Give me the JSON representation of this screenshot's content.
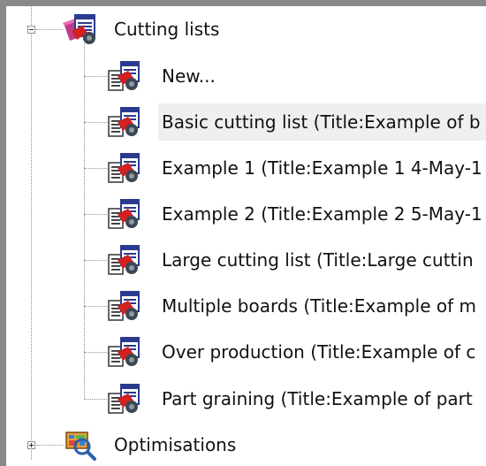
{
  "tree": {
    "root": {
      "label": "Cutting lists",
      "expanded": true,
      "icon": "cutting-list-folder-icon",
      "children": [
        {
          "label": "New...",
          "icon": "cutting-list-doc-icon"
        },
        {
          "label": "Basic cutting list (Title:Example of b",
          "icon": "cutting-list-doc-icon",
          "selected": true
        },
        {
          "label": "Example 1 (Title:Example 1 4-May-1",
          "icon": "cutting-list-doc-icon"
        },
        {
          "label": "Example 2 (Title:Example 2 5-May-1",
          "icon": "cutting-list-doc-icon"
        },
        {
          "label": "Large cutting list (Title:Large cuttin",
          "icon": "cutting-list-doc-icon"
        },
        {
          "label": "Multiple boards (Title:Example of m",
          "icon": "cutting-list-doc-icon"
        },
        {
          "label": "Over production (Title:Example of c",
          "icon": "cutting-list-doc-icon"
        },
        {
          "label": "Part graining (Title:Example of part",
          "icon": "cutting-list-doc-icon"
        }
      ]
    },
    "second": {
      "label": "Optimisations",
      "expanded": false,
      "icon": "optimisations-icon"
    }
  },
  "colors": {
    "selection": "#efefef",
    "tree_lines": "#8f8f8f",
    "frame": "#8a8a8a"
  }
}
